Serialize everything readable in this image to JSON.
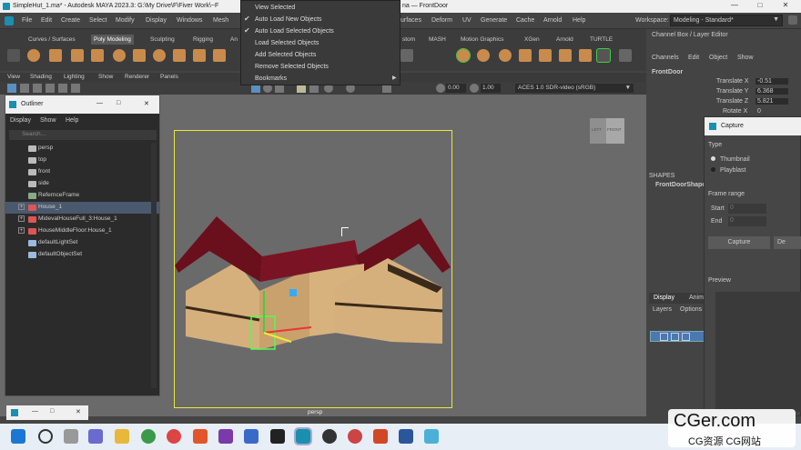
{
  "window": {
    "title": "SimpleHut_1.ma* - Autodesk MAYA 2023.3: G:\\My Drive\\F\\Fiver Work\\~F",
    "title_right": "na — FrontDoor",
    "min": "—",
    "max": "□",
    "close": "✕"
  },
  "menus": [
    "File",
    "Edit",
    "Create",
    "Select",
    "Modify",
    "Display",
    "Windows",
    "Mesh",
    "urfaces",
    "Deform",
    "UV",
    "Generate",
    "Cache",
    "Arnold",
    "Help"
  ],
  "workspace": {
    "label": "Workspace:",
    "value": "Modeling - Standard*"
  },
  "shelf_tabs": [
    "Curves / Surfaces",
    "Poly Modeling",
    "Sculpting",
    "Rigging",
    "An",
    "stom",
    "MASH",
    "Motion Graphics",
    "XGen",
    "Arnold",
    "TURTLE"
  ],
  "shelf_active": "Poly Modeling",
  "panel_menus": [
    "View",
    "Shading",
    "Lighting",
    "Show",
    "Renderer",
    "Panels"
  ],
  "viewtool": {
    "v1": "0.00",
    "v2": "1.00",
    "colorspace": "ACES 1.0 SDR-video (sRGB)"
  },
  "popup": {
    "items": [
      {
        "label": "View Selected",
        "checked": false
      },
      {
        "label": "Auto Load New Objects",
        "checked": true
      },
      {
        "label": "Auto Load Selected Objects",
        "checked": true
      },
      {
        "label": "Load Selected Objects",
        "checked": false
      },
      {
        "label": "Add Selected Objects",
        "checked": false
      },
      {
        "label": "Remove Selected Objects",
        "checked": false
      },
      {
        "label": "Bookmarks",
        "checked": false
      }
    ]
  },
  "outliner": {
    "title": "Outliner",
    "menus": [
      "Display",
      "Show",
      "Help"
    ],
    "search_placeholder": "Search...",
    "items": [
      {
        "label": "persp",
        "icon": "camera-icon",
        "expand": false,
        "selected": false
      },
      {
        "label": "top",
        "icon": "camera-icon",
        "expand": false,
        "selected": false
      },
      {
        "label": "front",
        "icon": "camera-icon",
        "expand": false,
        "selected": false
      },
      {
        "label": "side",
        "icon": "camera-icon",
        "expand": false,
        "selected": false
      },
      {
        "label": "RefernceFrame",
        "icon": "imageplane-icon",
        "expand": false,
        "selected": false
      },
      {
        "label": "House_1",
        "icon": "mesh-icon",
        "expand": true,
        "selected": true
      },
      {
        "label": "MidevalHouseFull_3:House_1",
        "icon": "mesh-icon",
        "expand": true,
        "selected": false
      },
      {
        "label": "HouseMiddleFloor:House_1",
        "icon": "mesh-icon",
        "expand": true,
        "selected": false
      },
      {
        "label": "defaultLightSet",
        "icon": "set-icon",
        "expand": false,
        "selected": false
      },
      {
        "label": "defaultObjectSet",
        "icon": "set-icon",
        "expand": false,
        "selected": false
      }
    ]
  },
  "viewport": {
    "camera_label": "persp",
    "viewcube_left": "LEFT",
    "viewcube_front": "FRONT"
  },
  "channelbox": {
    "title": "Channel Box / Layer Editor",
    "menus": [
      "Channels",
      "Edit",
      "Object",
      "Show"
    ],
    "object": "FrontDoor",
    "attrs": [
      {
        "name": "Translate X",
        "value": "-0.51"
      },
      {
        "name": "Translate Y",
        "value": "6.368"
      },
      {
        "name": "Translate Z",
        "value": "5.821"
      },
      {
        "name": "Rotate X",
        "value": "0"
      }
    ],
    "shapes_label": "SHAPES",
    "shape_name": "FrontDoorShape",
    "tabs": [
      "Display",
      "Anim"
    ],
    "layer_menus": [
      "Layers",
      "Options"
    ]
  },
  "capture": {
    "title": "Capture",
    "type_label": "Type",
    "opt1": "Thumbnail",
    "opt2": "Playblast",
    "range_label": "Frame range",
    "start_label": "Start",
    "start": "0",
    "end_label": "End",
    "end": "0",
    "btn1": "Capture",
    "btn2": "De",
    "preview": "Preview"
  },
  "watermark": {
    "main": "CGer.com",
    "sub": "CG资源 CG网站"
  }
}
